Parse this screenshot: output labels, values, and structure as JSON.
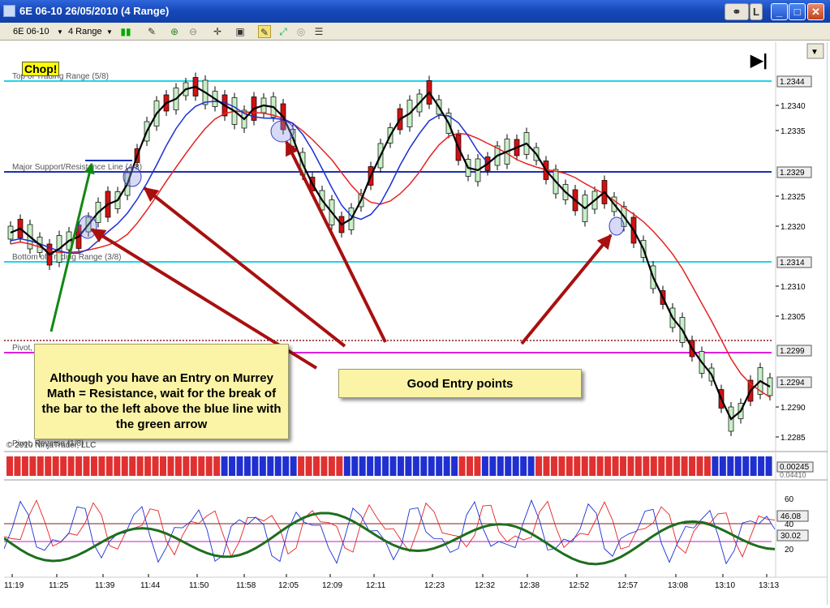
{
  "window": {
    "title": "6E 06-10  26/05/2010 (4 Range)",
    "btn_l": "L",
    "btn_min": "_",
    "btn_max": "□",
    "btn_close": "✕"
  },
  "toolbar": {
    "instrument": "6E 06-10",
    "period": "4 Range",
    "scroll_glyph": "▼",
    "end_glyph": "▶|"
  },
  "price_axis": {
    "ticks": [
      "1.2340",
      "1.2335",
      "1.2325",
      "1.2320",
      "1.2310",
      "1.2305",
      "1.2290",
      "1.2285"
    ],
    "badges": [
      "1.2344",
      "1.2329",
      "1.2314",
      "1.2299",
      "1.2294"
    ]
  },
  "murrey": {
    "top_label": "Top of Trading Range (5/8)",
    "major_label": "Major Support/Resistance Line (4/8)",
    "bottom_label": "Bottom of Trading Range (3/8)",
    "pivot_label": "Pivot, Reverse (2/8)",
    "lower_label": "Pivot, Reverse (1/8)"
  },
  "annotations": {
    "chop": "Chop!",
    "note1": "Although you have an Entry on Murrey Math = Resistance, wait for the break of the bar to the left above the blue line with the green arrow",
    "note2": "Good Entry points"
  },
  "copyright": "© 2010 NinjaTrader, LLC",
  "indicator1": {
    "value1": "0.00245",
    "value2": "0.04410"
  },
  "indicator2": {
    "ticks": [
      "60",
      "40",
      "20"
    ],
    "badges": [
      "46.08",
      "30.02"
    ]
  },
  "time_axis": [
    "11:19",
    "11:25",
    "11:39",
    "11:44",
    "11:50",
    "11:58",
    "12:05",
    "12:09",
    "12:11",
    "12:23",
    "12:32",
    "12:38",
    "12:52",
    "12:57",
    "13:08",
    "13:10",
    "13:13"
  ],
  "colors": {
    "up_candle": "#c8f0c8",
    "down_candle": "#d11111",
    "fast_ma": "#000000",
    "mid_ma": "#1a2fd6",
    "slow_ma": "#e52222",
    "cyan_line": "#22d5e8",
    "blue_line": "#1a2fb8",
    "magenta_line": "#e020e0",
    "arrow_red": "#a81010",
    "arrow_green": "#118811"
  }
}
